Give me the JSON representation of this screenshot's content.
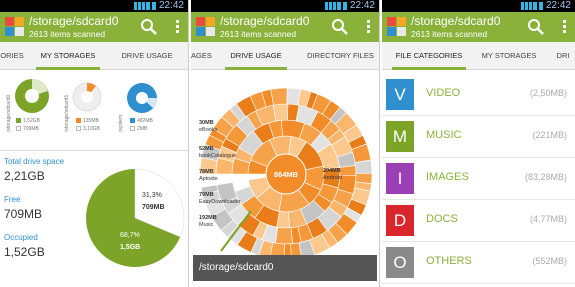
{
  "status": {
    "time": "22:42"
  },
  "app": {
    "title": "/storage/sdcard0",
    "subtitle": "2613 items scanned"
  },
  "panel1": {
    "tabs": [
      "ORIES",
      "MY STORAGES",
      "DRIVE USAGE"
    ],
    "disks": [
      {
        "label": "/storage/sdcard0",
        "used": "1,52GB",
        "free": "709MB"
      },
      {
        "label": "/storage/sdcard1",
        "used": "135MB",
        "free": "3,10GB"
      },
      {
        "label": "/system",
        "used": "482MB",
        "free": "2MB"
      }
    ],
    "stats": [
      {
        "label": "Total drive space",
        "value": "2,21GB"
      },
      {
        "label": "Free",
        "value": "709MB"
      },
      {
        "label": "Occupied",
        "value": "1,52GB"
      }
    ],
    "pie": {
      "free_pct": "31,3%",
      "free_val": "709MB",
      "used_pct": "68,7%",
      "used_val": "1,5GB",
      "used_fraction": 0.687
    },
    "colors": {
      "used": "#7ba428",
      "free": "#ffffff",
      "blue": "#2f8fcf",
      "orange": "#f28c28",
      "green": "#8ab13a"
    }
  },
  "panel2": {
    "tabs": [
      "AGES",
      "DRIVE USAGE",
      "DIRECTORY FILES"
    ],
    "center": "864MB",
    "labels": [
      {
        "size": "30MB",
        "name": "eBooks"
      },
      {
        "size": "52MB",
        "name": "bookCatalogue"
      },
      {
        "size": "78MB",
        "name": "Aptoide"
      },
      {
        "size": "79MB",
        "name": "EasyDownloader"
      },
      {
        "size": "192MB",
        "name": "Music"
      },
      {
        "size": "204MB",
        "name": "Android"
      }
    ],
    "path": "/storage/sdcard0"
  },
  "panel3": {
    "tabs": [
      "FILE CATEGORIES",
      "MY STORAGES",
      "DRI"
    ],
    "categories": [
      {
        "letter": "V",
        "name": "VIDEO",
        "size": "(2,50MB)",
        "color": "#2f8fcf"
      },
      {
        "letter": "M",
        "name": "MUSIC",
        "size": "(221MB)",
        "color": "#7ba428"
      },
      {
        "letter": "I",
        "name": "IMAGES",
        "size": "(83,28MB)",
        "color": "#9b3fb5"
      },
      {
        "letter": "D",
        "name": "DOCS",
        "size": "(4,77MB)",
        "color": "#d9262c"
      },
      {
        "letter": "O",
        "name": "OTHERS",
        "size": "(552MB)",
        "color": "#8a8a8a"
      }
    ]
  }
}
